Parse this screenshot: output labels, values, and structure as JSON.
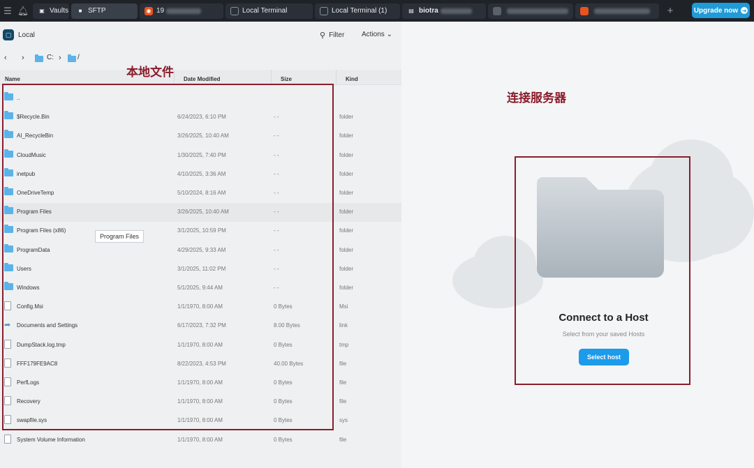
{
  "topbar": {
    "tabs": [
      {
        "label": "Vaults",
        "icon": "vault-icon"
      },
      {
        "label": "SFTP",
        "icon": "folder-icon",
        "active": true
      },
      {
        "label": "19",
        "icon": "ubuntu-icon",
        "blurred": true
      },
      {
        "label": "Local Terminal",
        "icon": "terminal-icon"
      },
      {
        "label": "Local Terminal (1)",
        "icon": "terminal-icon"
      },
      {
        "label": "biotra",
        "icon": "sftp-icon",
        "blurred": true
      },
      {
        "label": "",
        "icon": "host-icon",
        "blurred": true
      },
      {
        "label": "",
        "icon": "ubuntu-icon",
        "blurred": true
      }
    ],
    "upgrade_label": "Upgrade now",
    "colors": {
      "bar": "#1f2328",
      "upgrade": "#1f9bd8"
    }
  },
  "left": {
    "title": "Local",
    "filter_label": "Filter",
    "actions_label": "Actions",
    "path": [
      "C:",
      "/"
    ],
    "columns": [
      "Name",
      "Date Modified",
      "Size",
      "Kind"
    ],
    "rows": [
      {
        "name": "..",
        "date": "",
        "size": "",
        "kind": "",
        "type": "folder"
      },
      {
        "name": "$Recycle.Bin",
        "date": "6/24/2023, 6:10 PM",
        "size": "- -",
        "kind": "folder",
        "type": "folder"
      },
      {
        "name": "AI_RecycleBin",
        "date": "3/26/2025, 10:40 AM",
        "size": "- -",
        "kind": "folder",
        "type": "folder"
      },
      {
        "name": "CloudMusic",
        "date": "1/30/2025, 7:40 PM",
        "size": "- -",
        "kind": "folder",
        "type": "folder"
      },
      {
        "name": "inetpub",
        "date": "4/10/2025, 3:36 AM",
        "size": "- -",
        "kind": "folder",
        "type": "folder"
      },
      {
        "name": "OneDriveTemp",
        "date": "5/10/2024, 8:16 AM",
        "size": "- -",
        "kind": "folder",
        "type": "folder"
      },
      {
        "name": "Program Files",
        "date": "3/26/2025, 10:40 AM",
        "size": "- -",
        "kind": "folder",
        "type": "folder"
      },
      {
        "name": "Program Files (x86)",
        "date": "3/1/2025, 10:59 PM",
        "size": "- -",
        "kind": "folder",
        "type": "folder"
      },
      {
        "name": "ProgramData",
        "date": "4/29/2025, 9:33 AM",
        "size": "- -",
        "kind": "folder",
        "type": "folder"
      },
      {
        "name": "Users",
        "date": "3/1/2025, 11:02 PM",
        "size": "- -",
        "kind": "folder",
        "type": "folder"
      },
      {
        "name": "Windows",
        "date": "5/1/2025, 9:44 AM",
        "size": "- -",
        "kind": "folder",
        "type": "folder"
      },
      {
        "name": "Config.Msi",
        "date": "1/1/1970, 8:00 AM",
        "size": "0 Bytes",
        "kind": "Msi",
        "type": "file"
      },
      {
        "name": "Documents and Settings",
        "date": "6/17/2023, 7:32 PM",
        "size": "8.00 Bytes",
        "kind": "link",
        "type": "link"
      },
      {
        "name": "DumpStack.log.tmp",
        "date": "1/1/1970, 8:00 AM",
        "size": "0 Bytes",
        "kind": "tmp",
        "type": "file"
      },
      {
        "name": "FFF179FE9AC8",
        "date": "8/22/2023, 4:53 PM",
        "size": "40.00 Bytes",
        "kind": "file",
        "type": "file"
      },
      {
        "name": "PerfLogs",
        "date": "1/1/1970, 8:00 AM",
        "size": "0 Bytes",
        "kind": "file",
        "type": "file"
      },
      {
        "name": "Recovery",
        "date": "1/1/1970, 8:00 AM",
        "size": "0 Bytes",
        "kind": "file",
        "type": "file"
      },
      {
        "name": "swapfile.sys",
        "date": "1/1/1970, 8:00 AM",
        "size": "0 Bytes",
        "kind": "sys",
        "type": "file"
      },
      {
        "name": "System Volume Information",
        "date": "1/1/1970, 8:00 AM",
        "size": "0 Bytes",
        "kind": "file",
        "type": "file"
      }
    ],
    "tooltip": "Program Files",
    "annotation_label": "本地文件"
  },
  "right": {
    "title": "Connect to a Host",
    "subtitle": "Select from your saved Hosts",
    "button_label": "Select host",
    "annotation_label": "连接服务器"
  },
  "colors": {
    "annotation": "#8b1c2b",
    "folder": "#5bb3ea",
    "button": "#1c9bea"
  }
}
